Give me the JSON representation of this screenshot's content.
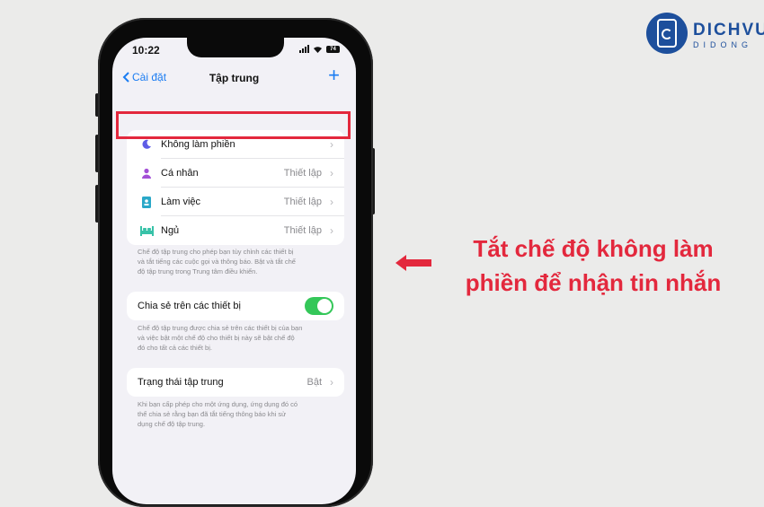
{
  "brand": {
    "line1": "DICHVU",
    "line2": "DIDONG"
  },
  "callout": {
    "line1": "Tắt chế độ không làm",
    "line2": "phiền để nhận tin nhắn",
    "color": "#e3283d"
  },
  "status_bar": {
    "time": "10:22",
    "battery": "74"
  },
  "nav": {
    "back_label": "Cài đặt",
    "title": "Tập trung",
    "add_icon": "plus-icon"
  },
  "focus_modes": [
    {
      "label": "Không làm phiền",
      "value": "",
      "icon": "moon-icon"
    },
    {
      "label": "Cá nhân",
      "value": "Thiết lập",
      "icon": "person-icon"
    },
    {
      "label": "Làm việc",
      "value": "Thiết lập",
      "icon": "badge-icon"
    },
    {
      "label": "Ngủ",
      "value": "Thiết lập",
      "icon": "bed-icon"
    }
  ],
  "focus_note": [
    "Chế độ tập trung cho phép bạn tùy chỉnh các thiết bị",
    "và tắt tiếng các cuộc gọi và thông báo. Bật và tắt chế",
    "độ tập trung trong Trung tâm điều khiển."
  ],
  "share": {
    "label": "Chia sẻ trên các thiết bị",
    "enabled": true
  },
  "share_note": [
    "Chế độ tập trung được chia sẻ trên các thiết bị của bạn",
    "và việc bật một chế độ cho thiết bị này sẽ bật chế độ",
    "đó cho tất cả các thiết bị."
  ],
  "focus_status": {
    "label": "Trạng thái tập trung",
    "value": "Bật"
  },
  "status_note": [
    "Khi bạn cấp phép cho một ứng dụng, ứng dụng đó có",
    "thể chia sẻ rằng bạn đã tắt tiếng thông báo khi sử",
    "dụng chế độ tập trung."
  ],
  "colors": {
    "accent": "#1a7cf2",
    "toggle": "#34c759",
    "moon": "#5e5ce6",
    "person": "#a34fd6",
    "badge": "#2aa8c8",
    "bed": "#38c2a8"
  }
}
